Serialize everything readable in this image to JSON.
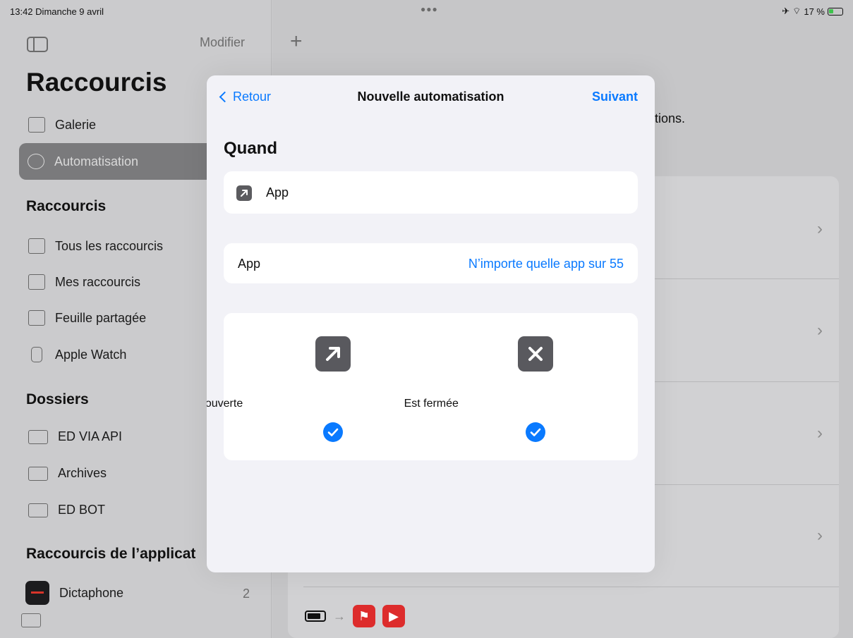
{
  "status_bar": {
    "time": "13:42",
    "date": "Dimanche 9 avril",
    "battery_percent": "17 %"
  },
  "sidebar": {
    "edit_label": "Modifier",
    "title": "Raccourcis",
    "items_top": [
      {
        "label": "Galerie"
      },
      {
        "label": "Automatisation"
      }
    ],
    "section_shortcuts": "Raccourcis",
    "shortcut_items": [
      {
        "label": "Tous les raccourcis"
      },
      {
        "label": "Mes raccourcis"
      },
      {
        "label": "Feuille partagée"
      },
      {
        "label": "Apple Watch"
      }
    ],
    "section_folders": "Dossiers",
    "folders": [
      {
        "label": "ED VIA API"
      },
      {
        "label": "Archives"
      },
      {
        "label": "ED BOT"
      }
    ],
    "section_app_shortcuts": "Raccourcis de l’applicat",
    "app_shortcuts": [
      {
        "label": "Dictaphone",
        "count": "2"
      }
    ]
  },
  "main": {
    "add_label": "+",
    "subtitle_fragment": "tions."
  },
  "sheet": {
    "back_label": "Retour",
    "title": "Nouvelle automatisation",
    "next_label": "Suivant",
    "when_heading": "Quand",
    "trigger_label": "App",
    "app_row": {
      "label": "App",
      "value": "N’importe quelle app sur 55"
    },
    "options": [
      {
        "label": "Est ouverte",
        "icon": "arrow-up-right-icon",
        "checked": true
      },
      {
        "label": "Est fermée",
        "icon": "xmark-icon",
        "checked": true
      }
    ]
  },
  "colors": {
    "accent": "#0a7aff",
    "sheet_bg": "#f2f2f7",
    "icon_bg": "#59595e"
  }
}
